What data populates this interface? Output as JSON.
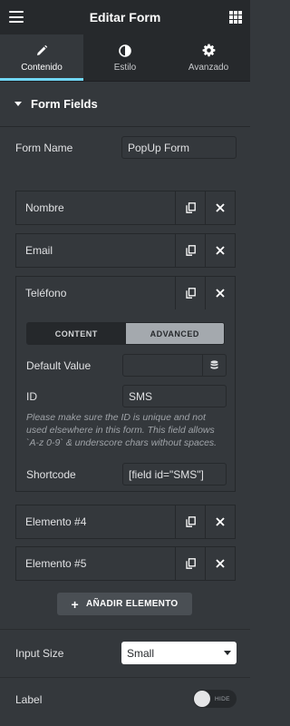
{
  "header": {
    "title": "Editar Form",
    "menu_icon": "hamburger-icon",
    "apps_icon": "grid-icon"
  },
  "tabs": [
    {
      "label": "Contenido",
      "icon": "pencil-icon",
      "active": true
    },
    {
      "label": "Estilo",
      "icon": "contrast-icon",
      "active": false
    },
    {
      "label": "Avanzado",
      "icon": "gear-icon",
      "active": false
    }
  ],
  "section": {
    "title": "Form Fields"
  },
  "form_name": {
    "label": "Form Name",
    "value": "PopUp Form"
  },
  "fields": [
    {
      "name": "Nombre"
    },
    {
      "name": "Email"
    },
    {
      "name": "Teléfono"
    },
    {
      "name": "Elemento #4"
    },
    {
      "name": "Elemento #5"
    }
  ],
  "editor": {
    "tab_content": "CONTENT",
    "tab_advanced": "ADVANCED",
    "default_value_label": "Default Value",
    "default_value": "",
    "id_label": "ID",
    "id_value": "SMS",
    "note": "Please make sure the ID is unique and not used elsewhere in this form. This field allows `A-z 0-9` & underscore chars without spaces.",
    "shortcode_label": "Shortcode",
    "shortcode_value": "[field id=\"SMS\"]"
  },
  "add_button": {
    "label": "AÑADIR ELEMENTO"
  },
  "input_size": {
    "label": "Input Size",
    "value": "Small"
  },
  "label_toggle": {
    "label": "Label",
    "state_text": "HIDE"
  },
  "colors": {
    "accent": "#71d7f7",
    "panel": "#34383c",
    "dark": "#26292c"
  }
}
